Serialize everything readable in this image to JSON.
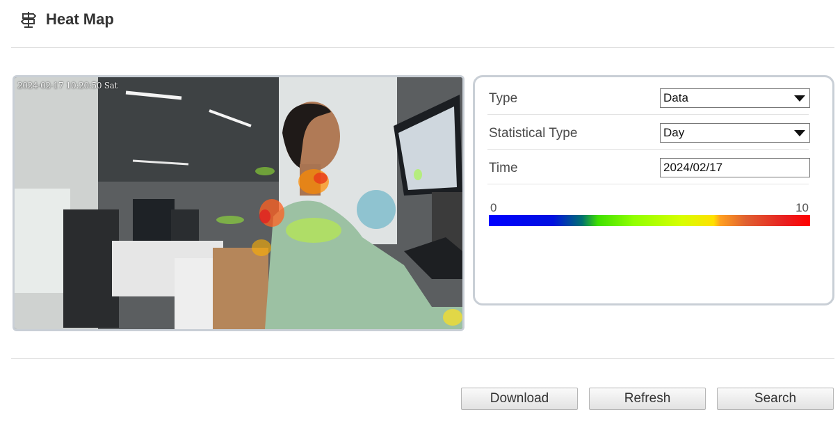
{
  "header": {
    "title": "Heat Map",
    "icon": "signpost-icon"
  },
  "video": {
    "osd_timestamp": "2024-02-17 10:20:50 Sat"
  },
  "form": {
    "type_label": "Type",
    "type_value": "Data",
    "stat_type_label": "Statistical Type",
    "stat_type_value": "Day",
    "time_label": "Time",
    "time_value": "2024/02/17"
  },
  "scale": {
    "min": "0",
    "max": "10",
    "colors": [
      "#0000ff",
      "#00c000",
      "#d8ff00",
      "#ffe000",
      "#e06030",
      "#ff0000"
    ]
  },
  "buttons": {
    "download": "Download",
    "refresh": "Refresh",
    "search": "Search"
  }
}
